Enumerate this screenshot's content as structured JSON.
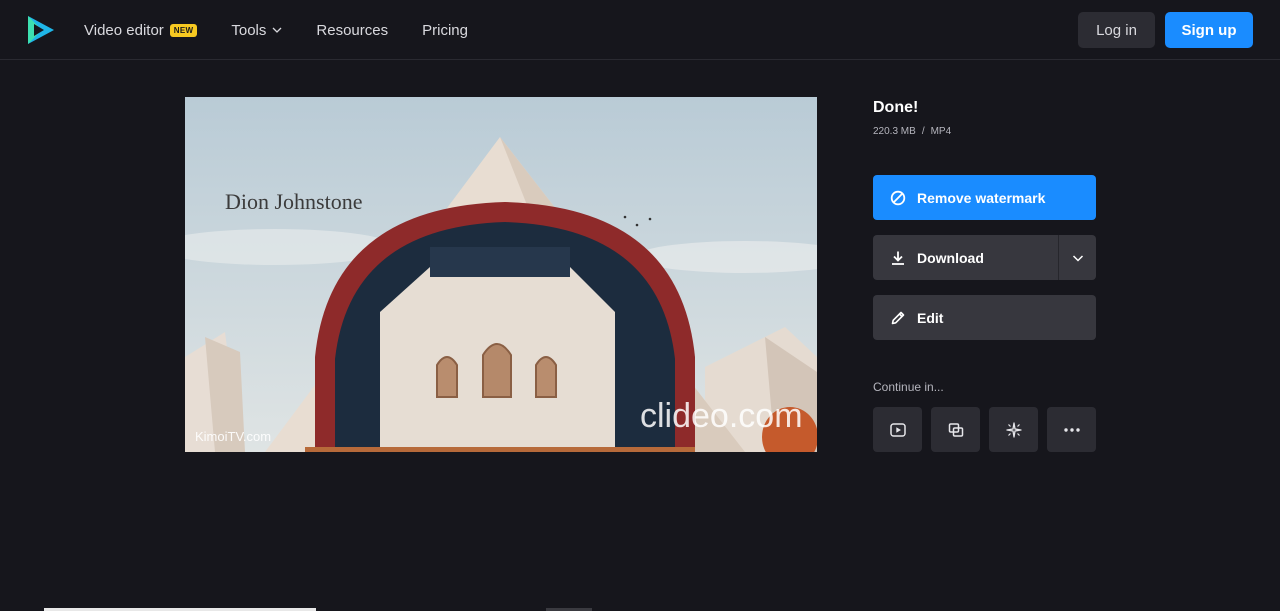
{
  "header": {
    "nav": {
      "video_editor": "Video editor",
      "new_badge": "NEW",
      "tools": "Tools",
      "resources": "Resources",
      "pricing": "Pricing"
    },
    "login": "Log in",
    "signup": "Sign up"
  },
  "video": {
    "title_text": "Dion Johnstone",
    "watermark": "clideo.com",
    "corner_mark": "KimoiTV.com"
  },
  "result": {
    "status": "Done!",
    "size": "220.3 MB",
    "separator": "/",
    "format": "MP4"
  },
  "actions": {
    "remove_watermark": "Remove watermark",
    "download": "Download",
    "edit": "Edit"
  },
  "continue_in": {
    "label": "Continue in...",
    "tools": [
      "video-player-icon",
      "merge-icon",
      "sparkle-icon",
      "more-icon"
    ]
  },
  "colors": {
    "background": "#16161c",
    "accent": "#1a8cff",
    "badge": "#f7c921",
    "button_secondary": "#37373e"
  }
}
